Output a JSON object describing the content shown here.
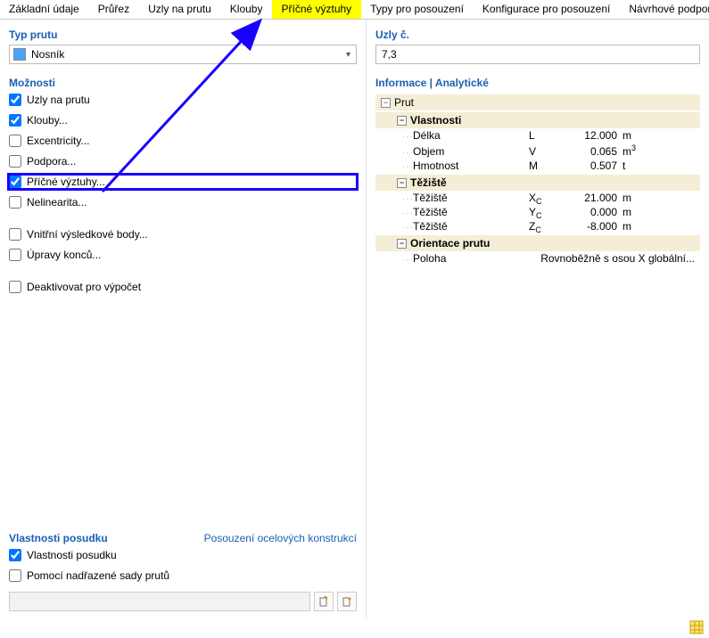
{
  "tabs": [
    "Základní údaje",
    "Průřez",
    "Uzly na prutu",
    "Klouby",
    "Příčné výztuhy",
    "Typy pro posouzení",
    "Konfigurace pro posouzení",
    "Návrhové podpory & prů"
  ],
  "tab_active_index": 4,
  "left": {
    "typ_prutu_header": "Typ prutu",
    "typ_prutu_value": "Nosník",
    "moznosti_header": "Možnosti",
    "options_a": [
      {
        "label": "Uzly na prutu",
        "checked": true
      },
      {
        "label": "Klouby...",
        "checked": true
      },
      {
        "label": "Excentricity...",
        "checked": false
      },
      {
        "label": "Podpora...",
        "checked": false
      },
      {
        "label": "Příčné výztuhy...",
        "checked": true,
        "highlight": true
      },
      {
        "label": "Nelinearita...",
        "checked": false
      }
    ],
    "options_b": [
      {
        "label": "Vnitřní výsledkové body...",
        "checked": false
      },
      {
        "label": "Úpravy konců...",
        "checked": false
      }
    ],
    "options_c": [
      {
        "label": "Deaktivovat pro výpočet",
        "checked": false
      }
    ],
    "posudek_header": "Vlastnosti posudku",
    "posudek_sub": "Posouzení ocelových konstrukcí",
    "posudek_opts": [
      {
        "label": "Vlastnosti posudku",
        "checked": true
      },
      {
        "label": "Pomocí nadřazené sady prutů",
        "checked": false
      }
    ]
  },
  "right": {
    "uzly_header": "Uzly č.",
    "uzly_value": "7,3",
    "info_header": "Informace | Analytické",
    "prut_label": "Prut",
    "groups": [
      {
        "title": "Vlastnosti",
        "rows": [
          {
            "label": "Délka",
            "sym": "L",
            "val": "12.000",
            "unit": "m"
          },
          {
            "label": "Objem",
            "sym": "V",
            "val": "0.065",
            "unit_html": "m<sup>3</sup>"
          },
          {
            "label": "Hmotnost",
            "sym": "M",
            "val": "0.507",
            "unit": "t"
          }
        ]
      },
      {
        "title": "Těžiště",
        "rows": [
          {
            "label": "Těžiště",
            "sym_html": "X<sub class='symsub'>C</sub>",
            "val": "21.000",
            "unit": "m"
          },
          {
            "label": "Těžiště",
            "sym_html": "Y<sub class='symsub'>C</sub>",
            "val": "0.000",
            "unit": "m"
          },
          {
            "label": "Těžiště",
            "sym_html": "Z<sub class='symsub'>C</sub>",
            "val": "-8.000",
            "unit": "m"
          }
        ]
      },
      {
        "title": "Orientace prutu",
        "rows_wide": [
          {
            "label": "Poloha",
            "valwide": "Rovnoběžně s osou X globální..."
          }
        ]
      }
    ]
  }
}
